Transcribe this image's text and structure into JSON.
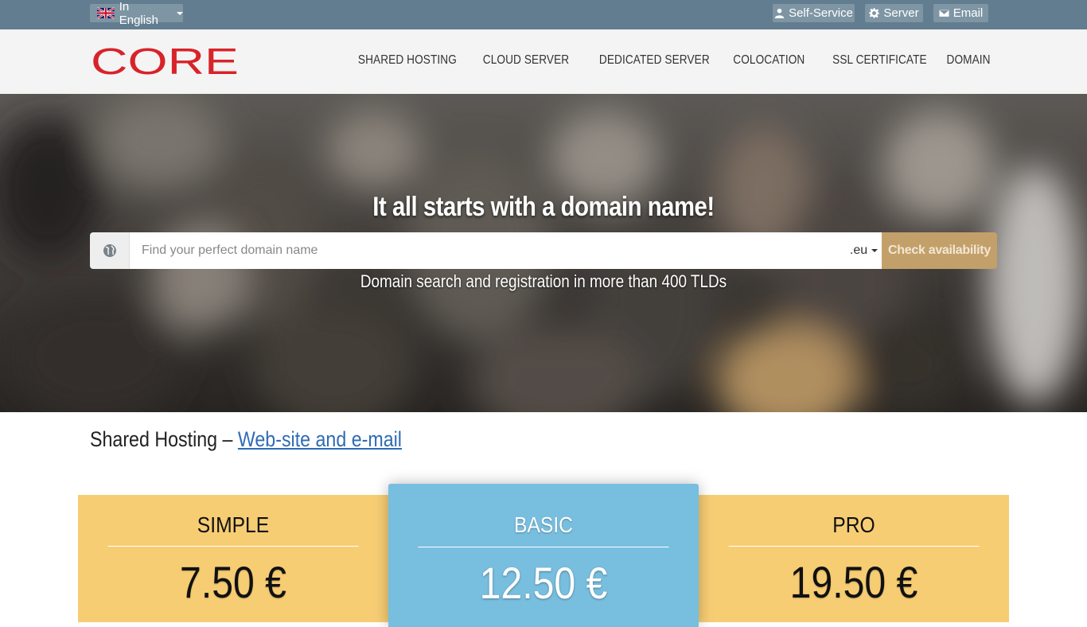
{
  "topbar": {
    "language_label": "In English",
    "buttons": [
      {
        "label": "Self-Service",
        "icon": "user-icon"
      },
      {
        "label": "Server",
        "icon": "gear-icon"
      },
      {
        "label": "Email",
        "icon": "envelope-icon"
      }
    ]
  },
  "header": {
    "logo_text": "CORE",
    "brand_color": "#d8232a",
    "nav": [
      "SHARED HOSTING",
      "CLOUD SERVER",
      "DEDICATED SERVER",
      "COLOCATION",
      "SSL CERTIFICATE",
      "DOMAIN"
    ]
  },
  "hero": {
    "title": "It all starts with a domain name!",
    "search": {
      "placeholder": "Find your perfect domain name",
      "value": "",
      "tld": ".eu",
      "button_label": "Check availability",
      "button_color": "#c3a06a"
    },
    "subtitle": "Domain search and registration in more than 400 TLDs"
  },
  "section": {
    "title_prefix": "Shared Hosting – ",
    "title_link": "Web-site and e-mail"
  },
  "plans": [
    {
      "name": "SIMPLE",
      "price": "7.50 €",
      "color": "#f7cd74"
    },
    {
      "name": "BASIC",
      "price": "12.50 €",
      "color": "#78bedf"
    },
    {
      "name": "PRO",
      "price": "19.50 €",
      "color": "#f7cd74"
    }
  ]
}
